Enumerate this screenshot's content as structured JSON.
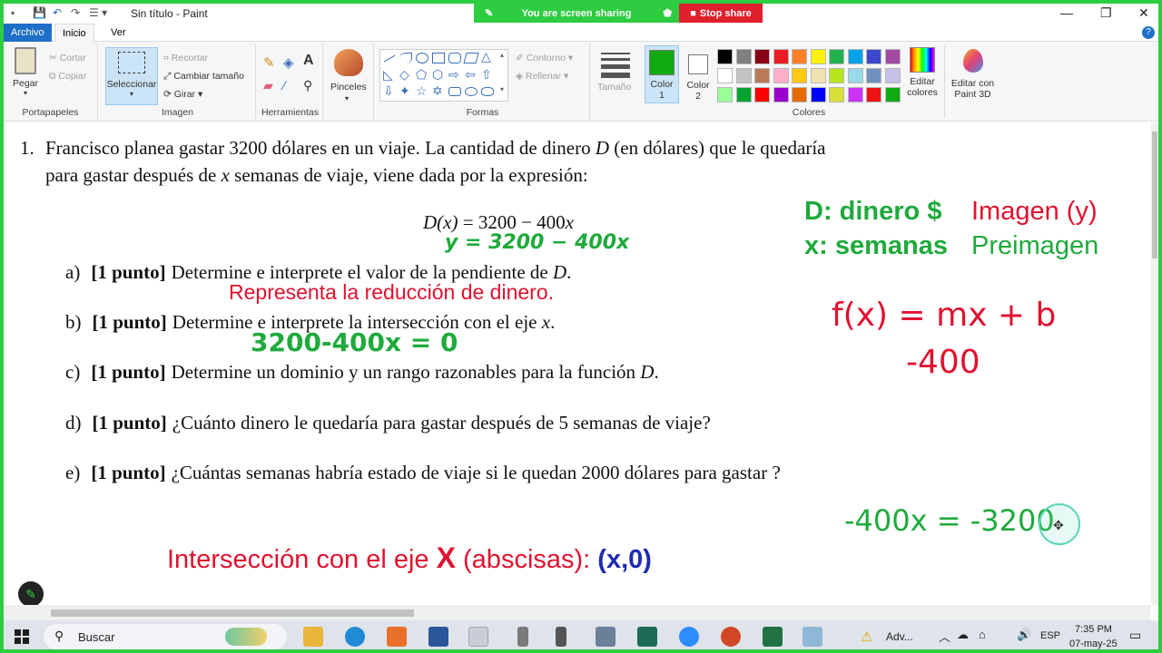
{
  "window": {
    "title": "Sin título - Paint"
  },
  "sharing": {
    "status": "You are screen sharing",
    "stop": "Stop share"
  },
  "tabs": {
    "file": "Archivo",
    "home": "Inicio",
    "view": "Ver"
  },
  "ribbon": {
    "clipboard": {
      "paste": "Pegar",
      "cut": "Cortar",
      "copy": "Copiar",
      "group": "Portapapeles"
    },
    "image": {
      "select": "Seleccionar",
      "crop": "Recortar",
      "resize": "Cambiar tamaño",
      "rotate": "Girar",
      "group": "Imagen"
    },
    "tools": {
      "group": "Herramientas"
    },
    "brushes": {
      "label": "Pinceles"
    },
    "shapes": {
      "outline": "Contorno",
      "fill": "Rellenar",
      "group": "Formas"
    },
    "size": {
      "label": "Tamaño"
    },
    "color1": {
      "label": "Color",
      "num": "1"
    },
    "color2": {
      "label": "Color",
      "num": "2"
    },
    "colors": {
      "group": "Colores",
      "edit": "Editar",
      "edit2": "colores",
      "paint3d": "Editar con",
      "paint3d2": "Paint 3D"
    },
    "palette": [
      "#000000",
      "#7f7f7f",
      "#880015",
      "#ed1c24",
      "#ff7f27",
      "#fff200",
      "#22b14c",
      "#00a2e8",
      "#3f48cc",
      "#a349a4",
      "#ffffff",
      "#c3c3c3",
      "#b97a57",
      "#ffaec9",
      "#ffc90e",
      "#efe4b0",
      "#b5e61d",
      "#99d9ea",
      "#7092be",
      "#c8bfe7",
      "#99ff99",
      "#00a331",
      "#ff0000",
      "#9900cc",
      "#e56a00",
      "#0000ff",
      "#d7de35",
      "#cc33ff",
      "#ee1111",
      "#11aa11"
    ]
  },
  "doc": {
    "number": "1.",
    "line1a": "Francisco planea gastar 3200 dólares en un viaje. La cantidad de dinero ",
    "line1var": "D",
    "line1b": " (en dólares) que le quedaría",
    "line2a": "para gastar después de ",
    "line2var": "x",
    "line2b": " semanas de viaje, viene dada por la expresión:",
    "formula_lhs": "D(x)",
    "formula_rhs": " = 3200 − 400",
    "formula_var": "x",
    "items": [
      {
        "letter": "a)",
        "pts": "[1 punto]",
        "text": "Determine e interprete el valor de la pendiente de ",
        "var": "D",
        "end": "."
      },
      {
        "letter": "b)",
        "pts": "[1 punto]",
        "text": "Determine e interprete la intersección con el eje ",
        "var": "x",
        "end": "."
      },
      {
        "letter": "c)",
        "pts": "[1 punto]",
        "text": "Determine un dominio y un rango razonables para la función ",
        "var": "D",
        "end": "."
      },
      {
        "letter": "d)",
        "pts": "[1 punto]",
        "text": "¿Cuánto dinero le quedaría para gastar después de 5 semanas de viaje?",
        "var": "",
        "end": ""
      },
      {
        "letter": "e)",
        "pts": "[1 punto]",
        "text": "¿Cuántas semanas habría estado de viaje si le quedan 2000 dólares para gastar ?",
        "var": "",
        "end": ""
      }
    ]
  },
  "annotations": {
    "dinero": "D: dinero $",
    "imagen": "Imagen (y)",
    "semanas": "x: semanas",
    "preimagen": "Preimagen",
    "y_eq": "y = 3200 − 400x",
    "reduccion": "Representa la reducción de dinero.",
    "eq_zero": "3200-400x = 0",
    "fx": "f(x) = mx + b",
    "minus400": "-400",
    "eq_final": "-400x = -3200",
    "intersec_a": "Intersección con el eje ",
    "intersec_x": "X",
    "intersec_b": " (abscisas): ",
    "intersec_pt": "(x,0)"
  },
  "taskbar": {
    "search": "Buscar",
    "tray_app": "Adv...",
    "lang": "ESP",
    "time": "7:35 PM",
    "date": "07-may-25"
  }
}
